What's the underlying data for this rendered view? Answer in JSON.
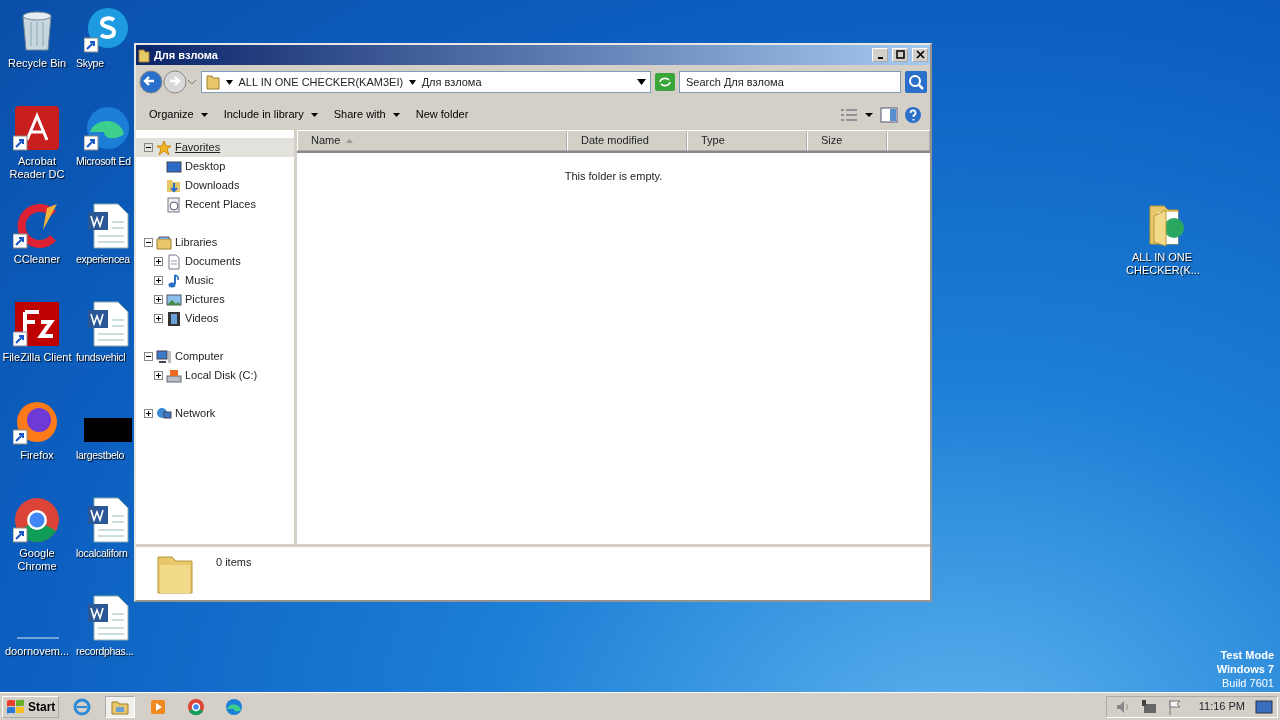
{
  "desktop_icons": [
    {
      "label": "Recycle Bin",
      "kind": "recycle",
      "shortcut": false
    },
    {
      "label": "Acrobat Reader DC",
      "kind": "acrobat",
      "shortcut": true
    },
    {
      "label": "CCleaner",
      "kind": "ccleaner",
      "shortcut": true
    },
    {
      "label": "FileZilla Client",
      "kind": "filezilla",
      "shortcut": true
    },
    {
      "label": "Firefox",
      "kind": "firefox",
      "shortcut": true
    },
    {
      "label": "Google Chrome",
      "kind": "chrome",
      "shortcut": true
    },
    {
      "label": "doornovem...",
      "kind": "blank",
      "shortcut": false
    },
    {
      "label": "Skype",
      "kind": "skype",
      "shortcut": true
    },
    {
      "label": "Microsoft Ed",
      "kind": "edge",
      "shortcut": true
    },
    {
      "label": "experienceа",
      "kind": "word",
      "shortcut": false
    },
    {
      "label": "fundsvehicl",
      "kind": "word",
      "shortcut": false
    },
    {
      "label": "largestbelo",
      "kind": "dark",
      "shortcut": false
    },
    {
      "label": "localcaliforn",
      "kind": "word",
      "shortcut": false
    },
    {
      "label": "recordphas...",
      "kind": "word",
      "shortcut": false
    }
  ],
  "desktop_folder": {
    "label": "ALL IN ONE CHECKER(K...",
    "kind": "folder"
  },
  "window": {
    "title": "Для взлома",
    "back_enabled": true,
    "forward_enabled": false,
    "breadcrumb": [
      "ALL IN ONE CHECKER(KAM3EI)",
      "Для взлома"
    ],
    "search": {
      "placeholder": "Search Для взлома"
    },
    "toolbar": [
      {
        "label": "Organize",
        "dropdown": true
      },
      {
        "label": "Include in library",
        "dropdown": true
      },
      {
        "label": "Share with",
        "dropdown": true
      },
      {
        "label": "New folder",
        "dropdown": false
      }
    ],
    "nav_tree": [
      {
        "label": "Favorites",
        "kind": "star",
        "expanded": true,
        "selected": true,
        "children": [
          {
            "label": "Desktop",
            "kind": "desktop",
            "selected": false
          },
          {
            "label": "Downloads",
            "kind": "downloads",
            "selected": false
          },
          {
            "label": "Recent Places",
            "kind": "recent",
            "selected": false
          }
        ]
      },
      {
        "label": "Libraries",
        "kind": "library",
        "expanded": true,
        "selected": false,
        "children": [
          {
            "label": "Documents",
            "kind": "documents",
            "expanded": false,
            "selected": false
          },
          {
            "label": "Music",
            "kind": "music",
            "expanded": false,
            "selected": false
          },
          {
            "label": "Pictures",
            "kind": "pictures",
            "expanded": false,
            "selected": false
          },
          {
            "label": "Videos",
            "kind": "videos",
            "expanded": false,
            "selected": false
          }
        ]
      },
      {
        "label": "Computer",
        "kind": "computer",
        "expanded": true,
        "selected": false,
        "children": [
          {
            "label": "Local Disk (C:)",
            "kind": "disk",
            "expanded": false,
            "selected": false
          }
        ]
      },
      {
        "label": "Network",
        "kind": "network",
        "expanded": false,
        "selected": false
      }
    ],
    "columns": [
      {
        "label": "Name",
        "sorted": true
      },
      {
        "label": "Date modified",
        "sorted": false
      },
      {
        "label": "Type",
        "sorted": false
      },
      {
        "label": "Size",
        "sorted": false
      }
    ],
    "empty_message": "This folder is empty.",
    "status": "0 items"
  },
  "system_notice": [
    "Test Mode",
    "Windows 7",
    "Build 7601"
  ],
  "taskbar": {
    "start": "Start",
    "apps": [
      {
        "kind": "ie",
        "selected": false
      },
      {
        "kind": "explorer",
        "selected": true
      },
      {
        "kind": "media",
        "selected": false
      },
      {
        "kind": "chrome",
        "selected": false
      },
      {
        "kind": "edge",
        "selected": false
      }
    ],
    "clock": "11:16 PM"
  }
}
